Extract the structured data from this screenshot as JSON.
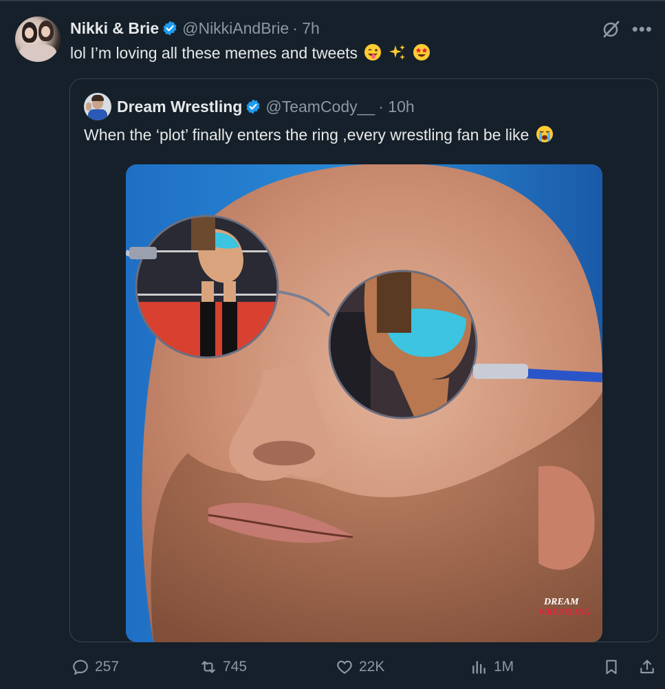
{
  "tweet": {
    "author_name": "Nikki & Brie",
    "author_handle": "@NikkiAndBrie",
    "time": "· 7h",
    "text": "lol I’m loving all these memes and tweets"
  },
  "quote": {
    "author_name": "Dream Wrestling",
    "author_handle": "@TeamCody__",
    "time": "· 10h",
    "text": "When the ‘plot’ finally enters the ring ,every wrestling fan be like",
    "watermark_top": "DREAM",
    "watermark_bottom": "WRESTLING"
  },
  "actions": {
    "replies": "257",
    "reposts": "745",
    "likes": "22K",
    "views": "1M"
  },
  "icons": {
    "verified": "verified-badge-icon",
    "grok": "grok-icon",
    "more": "more-icon",
    "reply": "reply-icon",
    "repost": "repost-icon",
    "like": "like-icon",
    "views": "views-icon",
    "bookmark": "bookmark-icon",
    "share": "share-icon"
  },
  "colors": {
    "background": "#16202a",
    "text": "#e7e9ea",
    "secondary": "#8b98a5",
    "verified": "#1d9bf0",
    "border": "#38444d"
  }
}
